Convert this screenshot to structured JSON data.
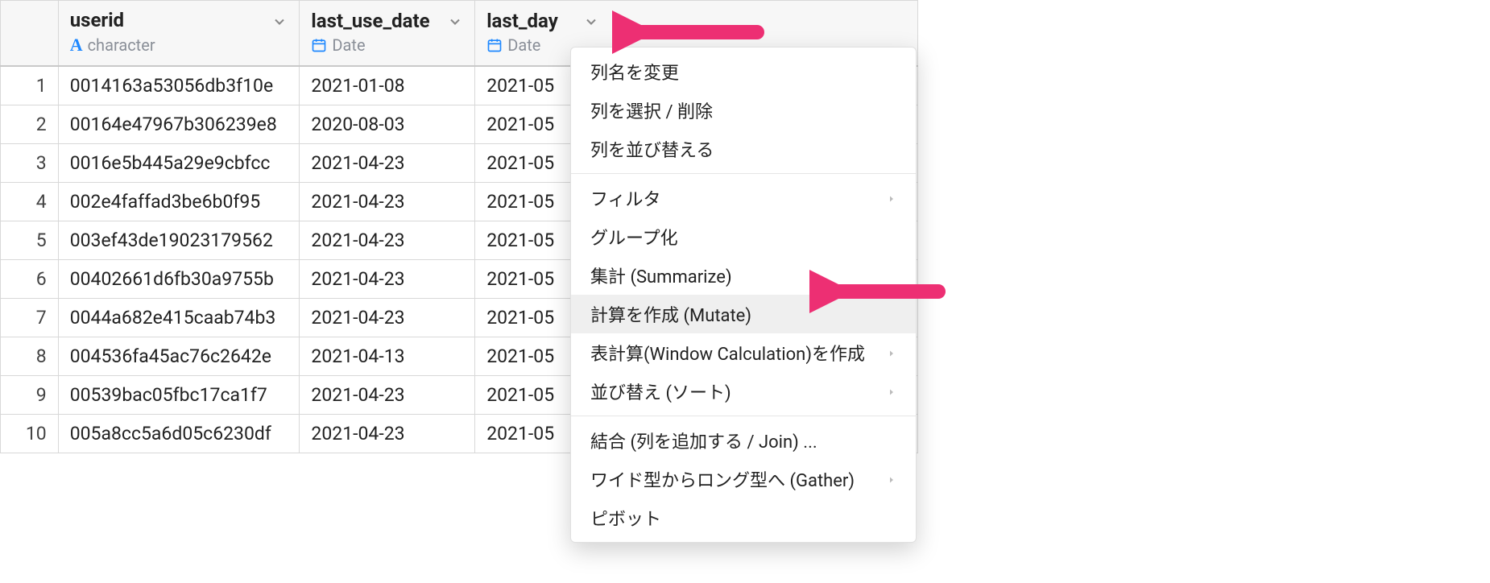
{
  "columns": {
    "userid": {
      "name": "userid",
      "type": "character"
    },
    "last_use_date": {
      "name": "last_use_date",
      "type": "Date"
    },
    "last_day": {
      "name": "last_day",
      "type": "Date"
    }
  },
  "rows": [
    {
      "n": "1",
      "userid": "0014163a53056db3f10e",
      "last_use_date": "2021-01-08",
      "last_day": "2021-05"
    },
    {
      "n": "2",
      "userid": "00164e47967b306239e8",
      "last_use_date": "2020-08-03",
      "last_day": "2021-05"
    },
    {
      "n": "3",
      "userid": "0016e5b445a29e9cbfcc",
      "last_use_date": "2021-04-23",
      "last_day": "2021-05"
    },
    {
      "n": "4",
      "userid": "002e4faffad3be6b0f95",
      "last_use_date": "2021-04-23",
      "last_day": "2021-05"
    },
    {
      "n": "5",
      "userid": "003ef43de19023179562",
      "last_use_date": "2021-04-23",
      "last_day": "2021-05"
    },
    {
      "n": "6",
      "userid": "00402661d6fb30a9755b",
      "last_use_date": "2021-04-23",
      "last_day": "2021-05"
    },
    {
      "n": "7",
      "userid": "0044a682e415caab74b3",
      "last_use_date": "2021-04-23",
      "last_day": "2021-05"
    },
    {
      "n": "8",
      "userid": "004536fa45ac76c2642e",
      "last_use_date": "2021-04-13",
      "last_day": "2021-05"
    },
    {
      "n": "9",
      "userid": "00539bac05fbc17ca1f7",
      "last_use_date": "2021-04-23",
      "last_day": "2021-05"
    },
    {
      "n": "10",
      "userid": "005a8cc5a6d05c6230df",
      "last_use_date": "2021-04-23",
      "last_day": "2021-05"
    }
  ],
  "menu": {
    "rename": "列名を変更",
    "select_remove": "列を選択 / 削除",
    "reorder": "列を並び替える",
    "filter": "フィルタ",
    "group": "グループ化",
    "summarize": "集計 (Summarize)",
    "mutate": "計算を作成 (Mutate)",
    "window": "表計算(Window Calculation)を作成",
    "sort": "並び替え (ソート)",
    "join": "結合 (列を追加する / Join) ...",
    "gather": "ワイド型からロング型へ (Gather)",
    "pivot": "ピボット"
  }
}
